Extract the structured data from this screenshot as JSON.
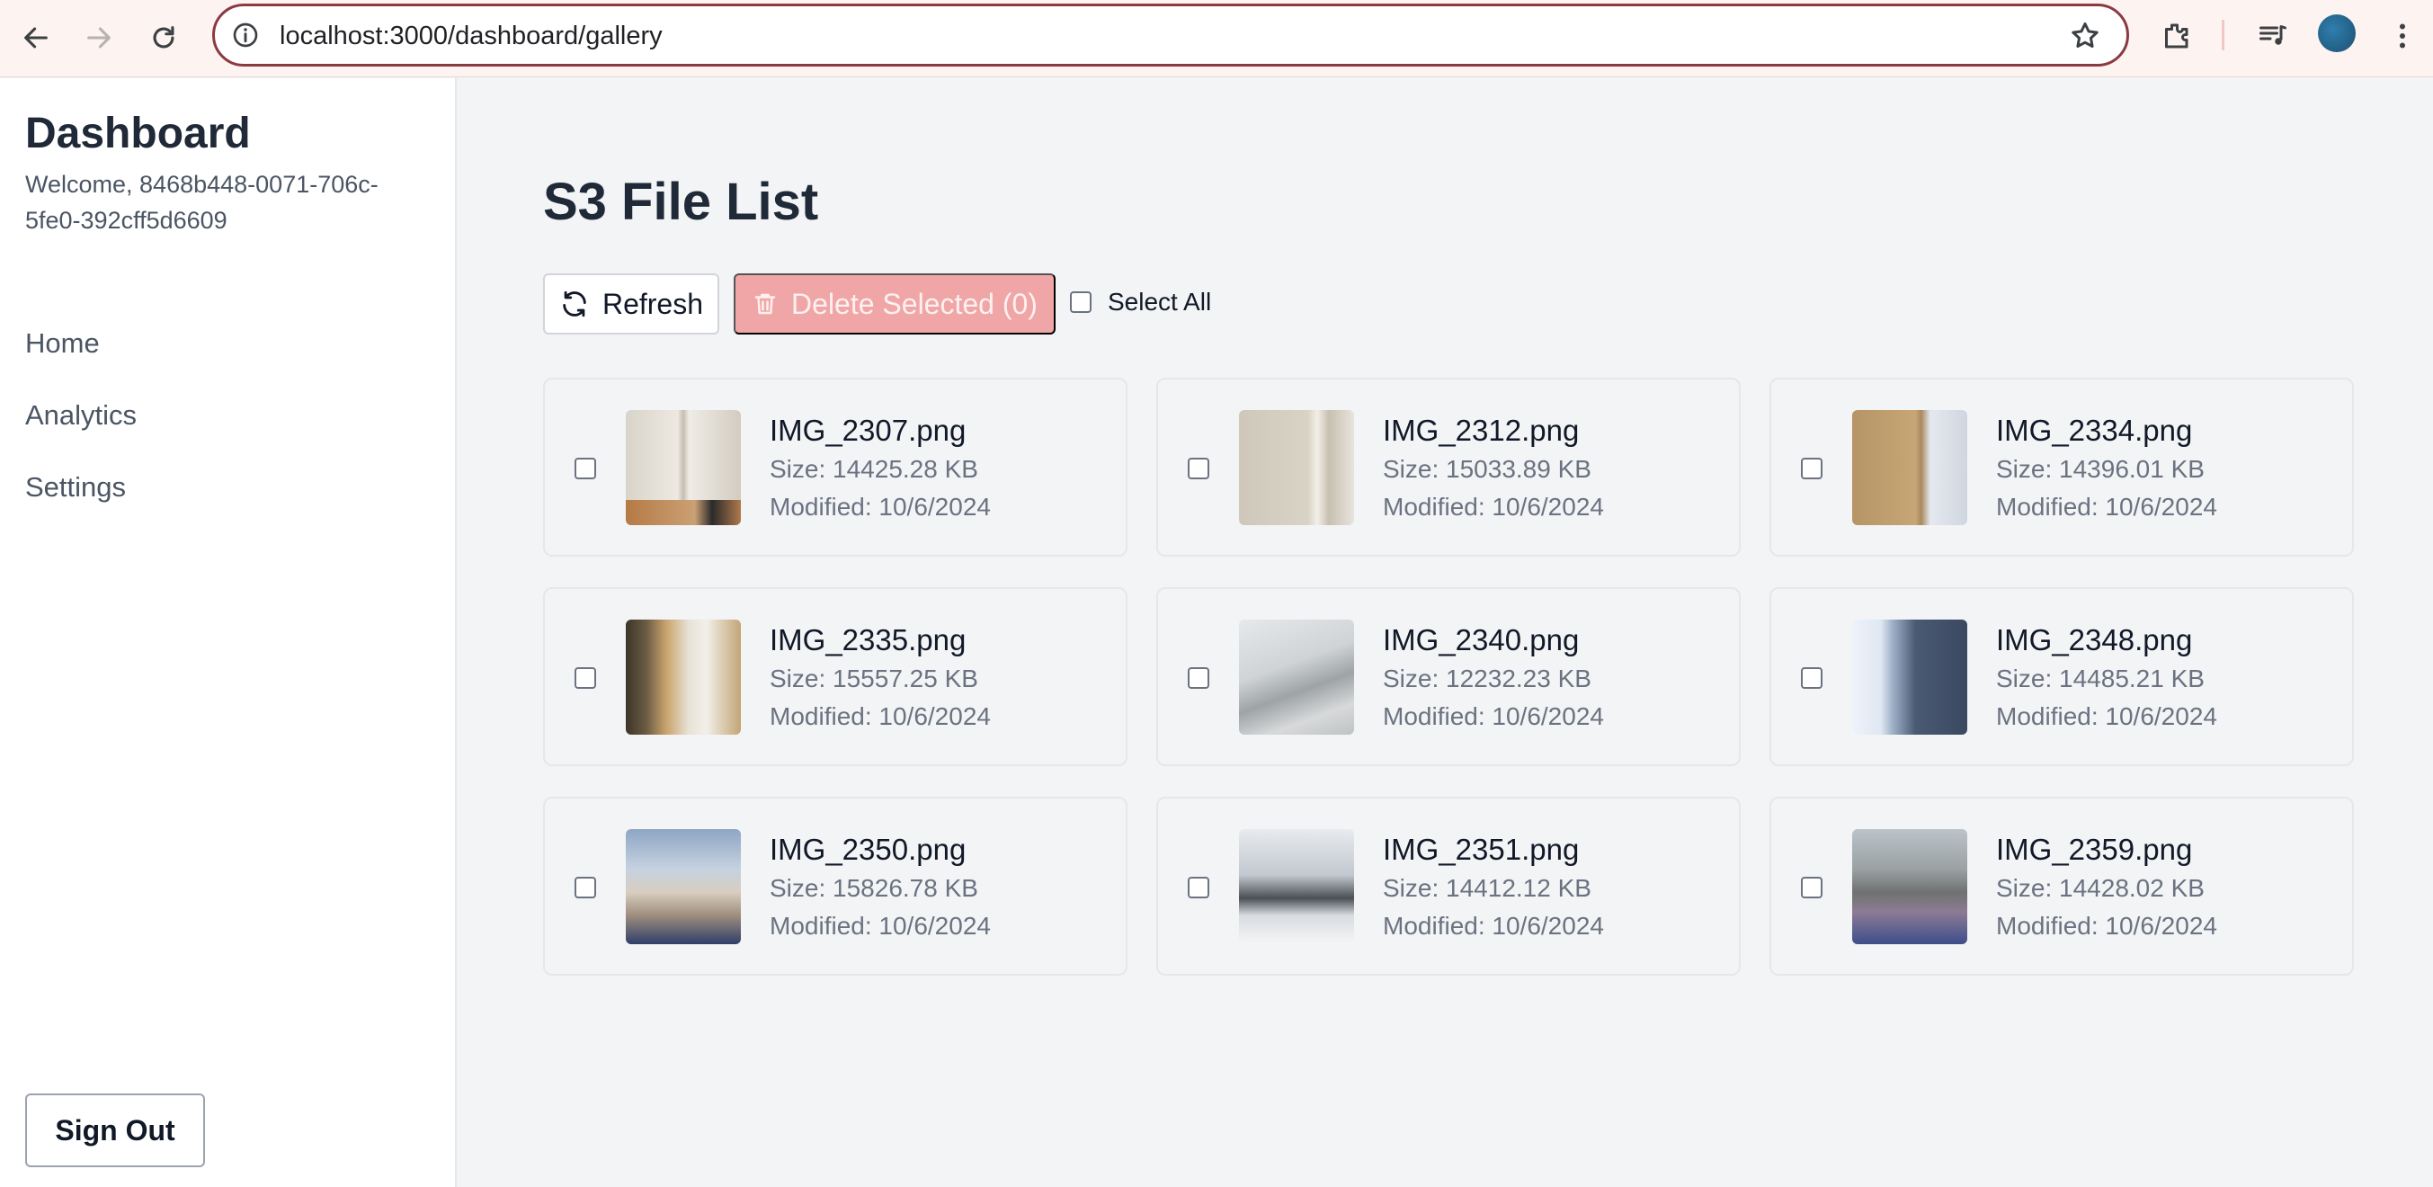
{
  "browser": {
    "url": "localhost:3000/dashboard/gallery"
  },
  "sidebar": {
    "title": "Dashboard",
    "welcome": "Welcome, 8468b448-0071-706c-5fe0-392cff5d6609",
    "items": [
      {
        "label": "Home"
      },
      {
        "label": "Analytics"
      },
      {
        "label": "Settings"
      }
    ],
    "sign_out": "Sign Out"
  },
  "main": {
    "title": "S3 File List",
    "refresh_label": "Refresh",
    "delete_label": "Delete Selected (0)",
    "select_all_label": "Select All",
    "files": [
      {
        "name": "IMG_2307.png",
        "size": "Size: 14425.28 KB",
        "modified": "Modified: 10/6/2024"
      },
      {
        "name": "IMG_2312.png",
        "size": "Size: 15033.89 KB",
        "modified": "Modified: 10/6/2024"
      },
      {
        "name": "IMG_2334.png",
        "size": "Size: 14396.01 KB",
        "modified": "Modified: 10/6/2024"
      },
      {
        "name": "IMG_2335.png",
        "size": "Size: 15557.25 KB",
        "modified": "Modified: 10/6/2024"
      },
      {
        "name": "IMG_2340.png",
        "size": "Size: 12232.23 KB",
        "modified": "Modified: 10/6/2024"
      },
      {
        "name": "IMG_2348.png",
        "size": "Size: 14485.21 KB",
        "modified": "Modified: 10/6/2024"
      },
      {
        "name": "IMG_2350.png",
        "size": "Size: 15826.78 KB",
        "modified": "Modified: 10/6/2024"
      },
      {
        "name": "IMG_2351.png",
        "size": "Size: 14412.12 KB",
        "modified": "Modified: 10/6/2024"
      },
      {
        "name": "IMG_2359.png",
        "size": "Size: 14428.02 KB",
        "modified": "Modified: 10/6/2024"
      }
    ]
  },
  "colors": {
    "delete_button": "#f0a6a6",
    "omnibox_border": "#8b3a42"
  },
  "icons": [
    "back-icon",
    "forward-icon",
    "reload-icon",
    "info-icon",
    "star-icon",
    "extensions-icon",
    "media-icon",
    "menu-icon",
    "refresh-icon",
    "trash-icon"
  ]
}
